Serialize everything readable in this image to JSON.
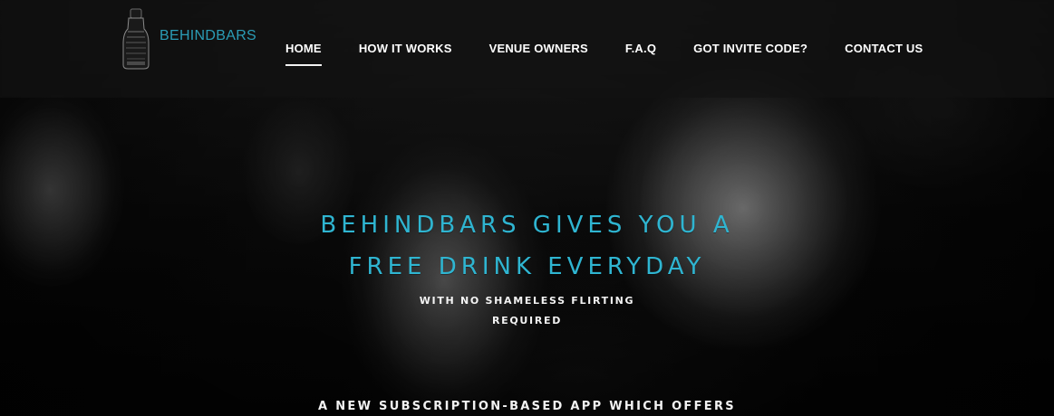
{
  "colors": {
    "accent": "#2fb5d1",
    "brand": "#2b9db6",
    "nav_bg": "#121212",
    "text_primary": "#ffffff"
  },
  "brand": {
    "logo_icon": "bottle-logo-icon",
    "name": "BEHINDBARS"
  },
  "nav": {
    "items": [
      {
        "label": "HOME",
        "active": true
      },
      {
        "label": "HOW IT WORKS",
        "active": false
      },
      {
        "label": "VENUE OWNERS",
        "active": false
      },
      {
        "label": "F.A.Q",
        "active": false
      },
      {
        "label": "GOT INVITE CODE?",
        "active": false
      },
      {
        "label": "CONTACT US",
        "active": false
      }
    ]
  },
  "hero": {
    "headline_lines": [
      "BEHINDBARS GIVES YOU A",
      "FREE DRINK EVERYDAY"
    ],
    "subhead_lines": [
      "WITH NO SHAMELESS FLIRTING",
      "REQUIRED"
    ],
    "tagline": "A NEW SUBSCRIPTION-BASED APP WHICH OFFERS"
  }
}
